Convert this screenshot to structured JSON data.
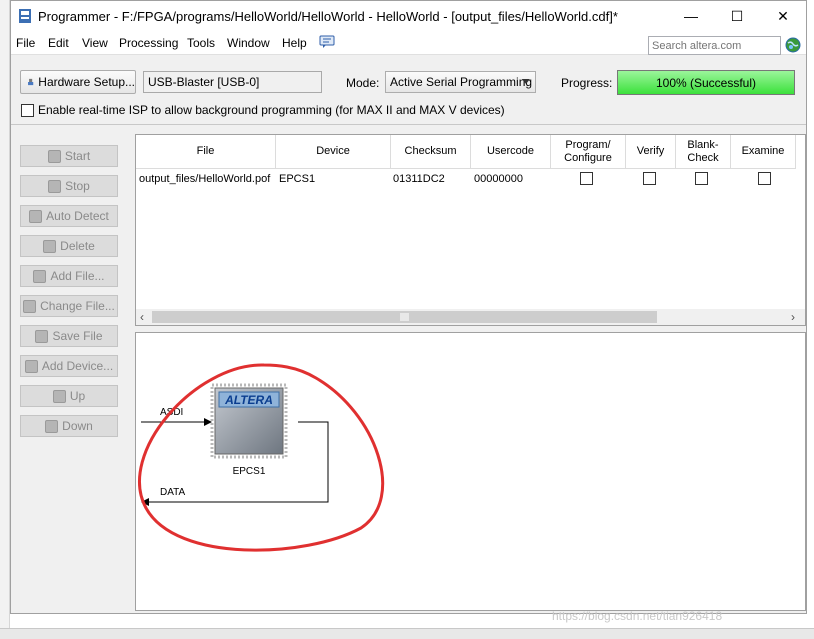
{
  "window": {
    "title": "Programmer - F:/FPGA/programs/HelloWorld/HelloWorld - HelloWorld - [output_files/HelloWorld.cdf]*",
    "minimize": "—",
    "maximize": "☐",
    "close": "✕"
  },
  "menu": {
    "items": [
      "File",
      "Edit",
      "View",
      "Processing",
      "Tools",
      "Window",
      "Help"
    ],
    "search_placeholder": "Search altera.com"
  },
  "hardware": {
    "setup_button": "Hardware Setup...",
    "device": "USB-Blaster [USB-0]",
    "mode_label": "Mode:",
    "mode_value": "Active Serial Programming",
    "progress_label": "Progress:",
    "progress_text": "100% (Successful)",
    "progress_value": 100,
    "isp_label": "Enable real-time ISP to allow background programming (for MAX II and MAX V devices)"
  },
  "actions": [
    "Start",
    "Stop",
    "Auto Detect",
    "Delete",
    "Add File...",
    "Change File...",
    "Save File",
    "Add Device...",
    "Up",
    "Down"
  ],
  "table": {
    "headers": [
      "File",
      "Device",
      "Checksum",
      "Usercode",
      "Program/ Configure",
      "Verify",
      "Blank- Check",
      "Examine"
    ],
    "rows": [
      {
        "file": "output_files/HelloWorld.pof",
        "device": "EPCS1",
        "checksum": "01311DC2",
        "usercode": "00000000"
      }
    ]
  },
  "chain": {
    "chip_logo": "ALTERA",
    "chip_name": "EPCS1",
    "in_label": "ASDI",
    "out_label": "DATA"
  },
  "watermark": "https://blog.csdn.net/tian926418"
}
